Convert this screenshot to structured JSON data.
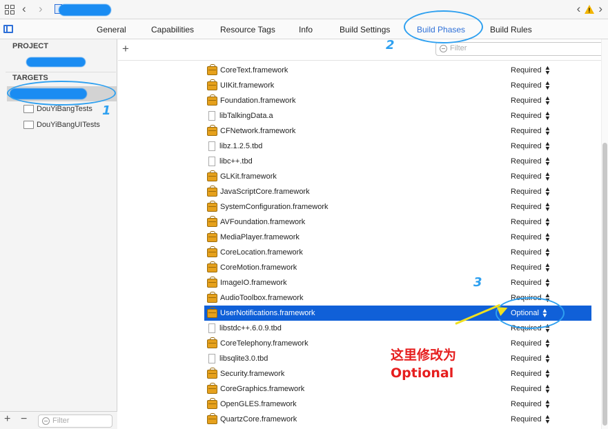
{
  "toolbar": {
    "back_glyph": "‹",
    "forward_glyph": "›"
  },
  "tabs": [
    {
      "label": "General"
    },
    {
      "label": "Capabilities"
    },
    {
      "label": "Resource Tags"
    },
    {
      "label": "Info"
    },
    {
      "label": "Build Settings"
    },
    {
      "label": "Build Phases",
      "active": true
    },
    {
      "label": "Build Rules"
    }
  ],
  "sidebar": {
    "project_header": "PROJECT",
    "targets_header": "TARGETS",
    "items": [
      {
        "label": "DouYiBangTests"
      },
      {
        "label": "DouYiBangUITests"
      }
    ],
    "add_glyph": "+",
    "remove_glyph": "−",
    "filter_placeholder": "Filter"
  },
  "main": {
    "add_glyph": "+",
    "filter_placeholder": "Filter",
    "frameworks": [
      {
        "name": "CoreText.framework",
        "kind": "framework",
        "status": "Required"
      },
      {
        "name": "UIKit.framework",
        "kind": "framework",
        "status": "Required"
      },
      {
        "name": "Foundation.framework",
        "kind": "framework",
        "status": "Required"
      },
      {
        "name": "libTalkingData.a",
        "kind": "library",
        "status": "Required"
      },
      {
        "name": "CFNetwork.framework",
        "kind": "framework",
        "status": "Required"
      },
      {
        "name": "libz.1.2.5.tbd",
        "kind": "library",
        "status": "Required"
      },
      {
        "name": "libc++.tbd",
        "kind": "library",
        "status": "Required"
      },
      {
        "name": "GLKit.framework",
        "kind": "framework",
        "status": "Required"
      },
      {
        "name": "JavaScriptCore.framework",
        "kind": "framework",
        "status": "Required"
      },
      {
        "name": "SystemConfiguration.framework",
        "kind": "framework",
        "status": "Required"
      },
      {
        "name": "AVFoundation.framework",
        "kind": "framework",
        "status": "Required"
      },
      {
        "name": "MediaPlayer.framework",
        "kind": "framework",
        "status": "Required"
      },
      {
        "name": "CoreLocation.framework",
        "kind": "framework",
        "status": "Required"
      },
      {
        "name": "CoreMotion.framework",
        "kind": "framework",
        "status": "Required"
      },
      {
        "name": "ImageIO.framework",
        "kind": "framework",
        "status": "Required"
      },
      {
        "name": "AudioToolbox.framework",
        "kind": "framework",
        "status": "Required"
      },
      {
        "name": "UserNotifications.framework",
        "kind": "framework",
        "status": "Optional",
        "selected": true
      },
      {
        "name": "libstdc++.6.0.9.tbd",
        "kind": "library",
        "status": "Required"
      },
      {
        "name": "CoreTelephony.framework",
        "kind": "framework",
        "status": "Required"
      },
      {
        "name": "libsqlite3.0.tbd",
        "kind": "library",
        "status": "Required"
      },
      {
        "name": "Security.framework",
        "kind": "framework",
        "status": "Required"
      },
      {
        "name": "CoreGraphics.framework",
        "kind": "framework",
        "status": "Required"
      },
      {
        "name": "OpenGLES.framework",
        "kind": "framework",
        "status": "Required"
      },
      {
        "name": "QuartzCore.framework",
        "kind": "framework",
        "status": "Required"
      }
    ]
  },
  "annotations": {
    "step1": "1",
    "step2": "2",
    "step3": "3",
    "note_line1": "这里修改为",
    "note_line2": "Optional",
    "annotation_color": "#2ea0f0",
    "note_color": "#e61e1e"
  },
  "colors": {
    "accent": "#2d6fd8",
    "selection": "#1060d8",
    "framework_icon": "#e6a11c",
    "warning": "#f2b500"
  }
}
